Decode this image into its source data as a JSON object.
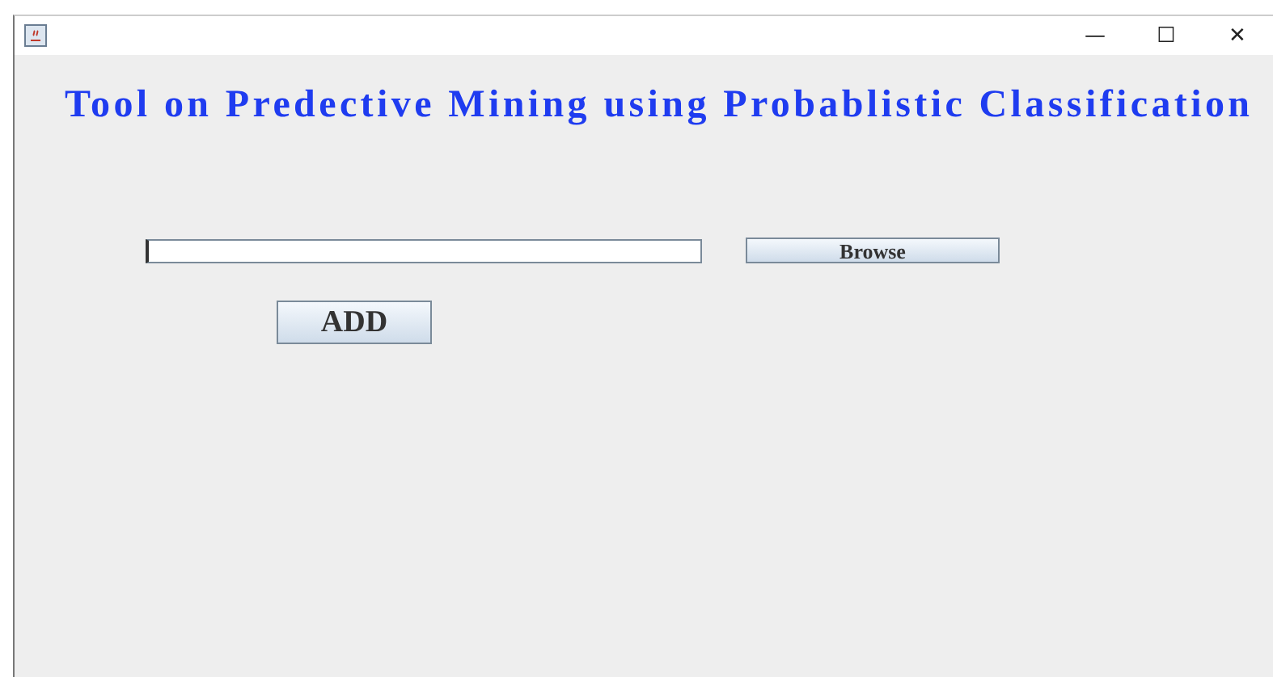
{
  "window": {
    "title_bar_buttons": [
      "—",
      "☐",
      "✕"
    ]
  },
  "heading": "Tool on Predective Mining using Probablistic Classification",
  "browse_button": "Browse",
  "add_button": "ADD"
}
